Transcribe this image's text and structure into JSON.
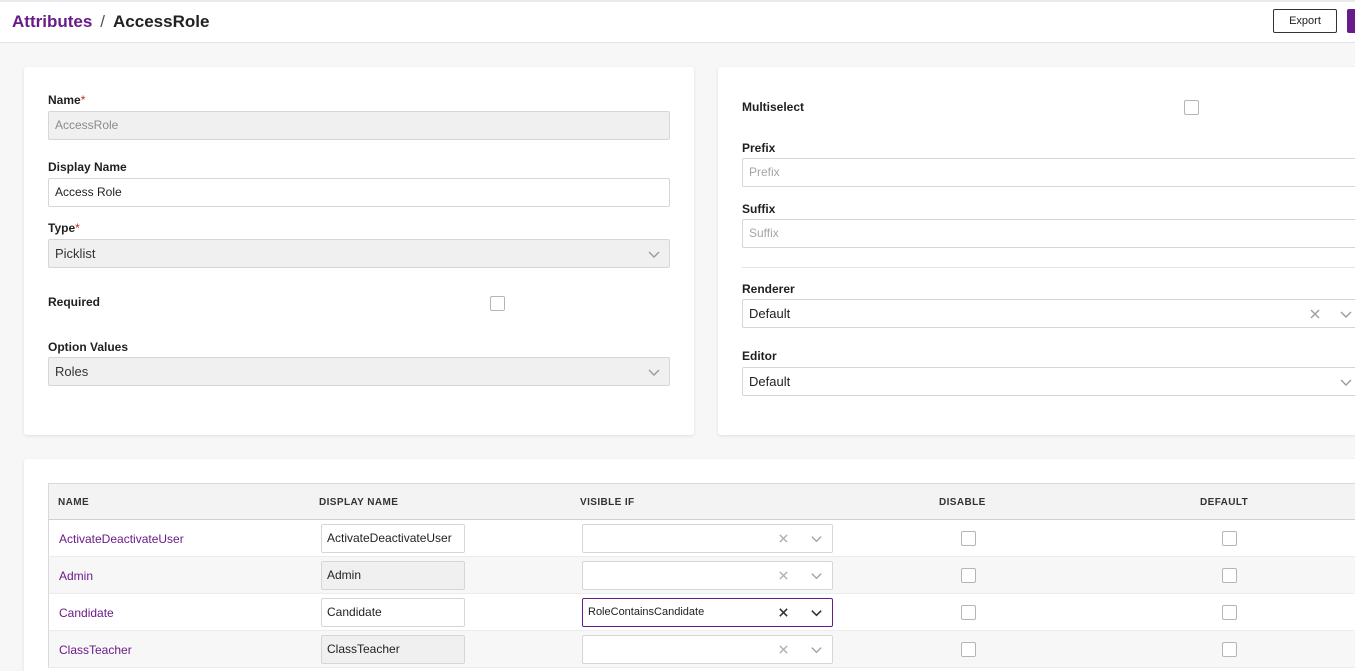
{
  "header": {
    "breadcrumb_root": "Attributes",
    "breadcrumb_separator": "/",
    "breadcrumb_current": "AccessRole",
    "export_label": "Export"
  },
  "left_form": {
    "name_label": "Name",
    "name_value": "AccessRole",
    "display_name_label": "Display Name",
    "display_name_value": "Access Role",
    "type_label": "Type",
    "type_value": "Picklist",
    "required_label": "Required",
    "option_values_label": "Option Values",
    "option_values_value": "Roles",
    "required_marker": "*"
  },
  "right_form": {
    "multiselect_label": "Multiselect",
    "prefix_label": "Prefix",
    "prefix_placeholder": "Prefix",
    "suffix_label": "Suffix",
    "suffix_placeholder": "Suffix",
    "renderer_label": "Renderer",
    "renderer_value": "Default",
    "editor_label": "Editor",
    "editor_value": "Default"
  },
  "table": {
    "columns": [
      "NAME",
      "DISPLAY NAME",
      "VISIBLE IF",
      "DISABLE",
      "DEFAULT"
    ],
    "rows": [
      {
        "name": "ActivateDeactivateUser",
        "display_name": "ActivateDeactivateUser",
        "visible_if": "",
        "editable": true
      },
      {
        "name": "Admin",
        "display_name": "Admin",
        "visible_if": "",
        "editable": false
      },
      {
        "name": "Candidate",
        "display_name": "Candidate",
        "visible_if": "RoleContainsCandidate",
        "editable": true
      },
      {
        "name": "ClassTeacher",
        "display_name": "ClassTeacher",
        "visible_if": "",
        "editable": false
      }
    ]
  },
  "colors": {
    "accent": "#6a1b8a",
    "required": "#c62828"
  }
}
